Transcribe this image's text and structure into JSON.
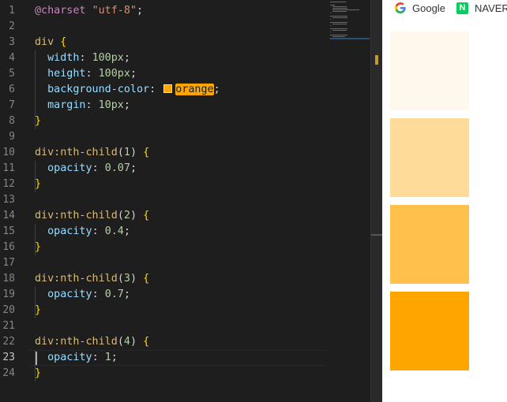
{
  "editor": {
    "active_line": 23,
    "lines": [
      {
        "n": "1",
        "tokens": [
          {
            "t": "at",
            "v": "@charset"
          },
          {
            "t": "punc",
            "v": " "
          },
          {
            "t": "str",
            "v": "\"utf-8\""
          },
          {
            "t": "punc",
            "v": ";"
          }
        ]
      },
      {
        "n": "2",
        "tokens": []
      },
      {
        "n": "3",
        "tokens": [
          {
            "t": "sel",
            "v": "div"
          },
          {
            "t": "punc",
            "v": " "
          },
          {
            "t": "brace",
            "v": "{"
          }
        ]
      },
      {
        "n": "4",
        "tokens": [
          {
            "t": "punc",
            "v": "  "
          },
          {
            "t": "prop",
            "v": "width"
          },
          {
            "t": "punc",
            "v": ": "
          },
          {
            "t": "num",
            "v": "100px"
          },
          {
            "t": "punc",
            "v": ";"
          }
        ]
      },
      {
        "n": "5",
        "tokens": [
          {
            "t": "punc",
            "v": "  "
          },
          {
            "t": "prop",
            "v": "height"
          },
          {
            "t": "punc",
            "v": ": "
          },
          {
            "t": "num",
            "v": "100px"
          },
          {
            "t": "punc",
            "v": ";"
          }
        ]
      },
      {
        "n": "6",
        "tokens": [
          {
            "t": "punc",
            "v": "  "
          },
          {
            "t": "prop",
            "v": "background-color"
          },
          {
            "t": "punc",
            "v": ": "
          },
          {
            "t": "swatch",
            "v": ""
          },
          {
            "t": "hl",
            "v": "orange"
          },
          {
            "t": "punc",
            "v": ";"
          }
        ]
      },
      {
        "n": "7",
        "tokens": [
          {
            "t": "punc",
            "v": "  "
          },
          {
            "t": "prop",
            "v": "margin"
          },
          {
            "t": "punc",
            "v": ": "
          },
          {
            "t": "num",
            "v": "10px"
          },
          {
            "t": "punc",
            "v": ";"
          }
        ]
      },
      {
        "n": "8",
        "tokens": [
          {
            "t": "brace",
            "v": "}"
          }
        ]
      },
      {
        "n": "9",
        "tokens": []
      },
      {
        "n": "10",
        "tokens": [
          {
            "t": "sel",
            "v": "div:nth-child"
          },
          {
            "t": "punc",
            "v": "("
          },
          {
            "t": "num",
            "v": "1"
          },
          {
            "t": "punc",
            "v": ") "
          },
          {
            "t": "brace",
            "v": "{"
          }
        ]
      },
      {
        "n": "11",
        "tokens": [
          {
            "t": "punc",
            "v": "  "
          },
          {
            "t": "prop",
            "v": "opacity"
          },
          {
            "t": "punc",
            "v": ": "
          },
          {
            "t": "num",
            "v": "0.07"
          },
          {
            "t": "punc",
            "v": ";"
          }
        ]
      },
      {
        "n": "12",
        "tokens": [
          {
            "t": "brace",
            "v": "}"
          }
        ]
      },
      {
        "n": "13",
        "tokens": []
      },
      {
        "n": "14",
        "tokens": [
          {
            "t": "sel",
            "v": "div:nth-child"
          },
          {
            "t": "punc",
            "v": "("
          },
          {
            "t": "num",
            "v": "2"
          },
          {
            "t": "punc",
            "v": ") "
          },
          {
            "t": "brace",
            "v": "{"
          }
        ]
      },
      {
        "n": "15",
        "tokens": [
          {
            "t": "punc",
            "v": "  "
          },
          {
            "t": "prop",
            "v": "opacity"
          },
          {
            "t": "punc",
            "v": ": "
          },
          {
            "t": "num",
            "v": "0.4"
          },
          {
            "t": "punc",
            "v": ";"
          }
        ]
      },
      {
        "n": "16",
        "tokens": [
          {
            "t": "brace",
            "v": "}"
          }
        ]
      },
      {
        "n": "17",
        "tokens": []
      },
      {
        "n": "18",
        "tokens": [
          {
            "t": "sel",
            "v": "div:nth-child"
          },
          {
            "t": "punc",
            "v": "("
          },
          {
            "t": "num",
            "v": "3"
          },
          {
            "t": "punc",
            "v": ") "
          },
          {
            "t": "brace",
            "v": "{"
          }
        ]
      },
      {
        "n": "19",
        "tokens": [
          {
            "t": "punc",
            "v": "  "
          },
          {
            "t": "prop",
            "v": "opacity"
          },
          {
            "t": "punc",
            "v": ": "
          },
          {
            "t": "num",
            "v": "0.7"
          },
          {
            "t": "punc",
            "v": ";"
          }
        ]
      },
      {
        "n": "20",
        "tokens": [
          {
            "t": "brace",
            "v": "}"
          }
        ]
      },
      {
        "n": "21",
        "tokens": []
      },
      {
        "n": "22",
        "tokens": [
          {
            "t": "sel",
            "v": "div:nth-child"
          },
          {
            "t": "punc",
            "v": "("
          },
          {
            "t": "num",
            "v": "4"
          },
          {
            "t": "punc",
            "v": ") "
          },
          {
            "t": "brace",
            "v": "{"
          }
        ]
      },
      {
        "n": "23",
        "tokens": [
          {
            "t": "punc",
            "v": "  "
          },
          {
            "t": "prop",
            "v": "opacity"
          },
          {
            "t": "punc",
            "v": ": "
          },
          {
            "t": "num",
            "v": "1"
          },
          {
            "t": "punc",
            "v": ";"
          }
        ]
      },
      {
        "n": "24",
        "tokens": [
          {
            "t": "brace",
            "v": "}"
          }
        ]
      }
    ]
  },
  "browser": {
    "bookmarks": [
      {
        "label": "Google",
        "icon": "google-icon"
      },
      {
        "label": "NAVER",
        "icon": "naver-icon",
        "icon_letter": "N"
      }
    ],
    "box_color": "#ffa500",
    "boxes": [
      {
        "opacity": 0.07
      },
      {
        "opacity": 0.4
      },
      {
        "opacity": 0.7
      },
      {
        "opacity": 1
      }
    ]
  }
}
